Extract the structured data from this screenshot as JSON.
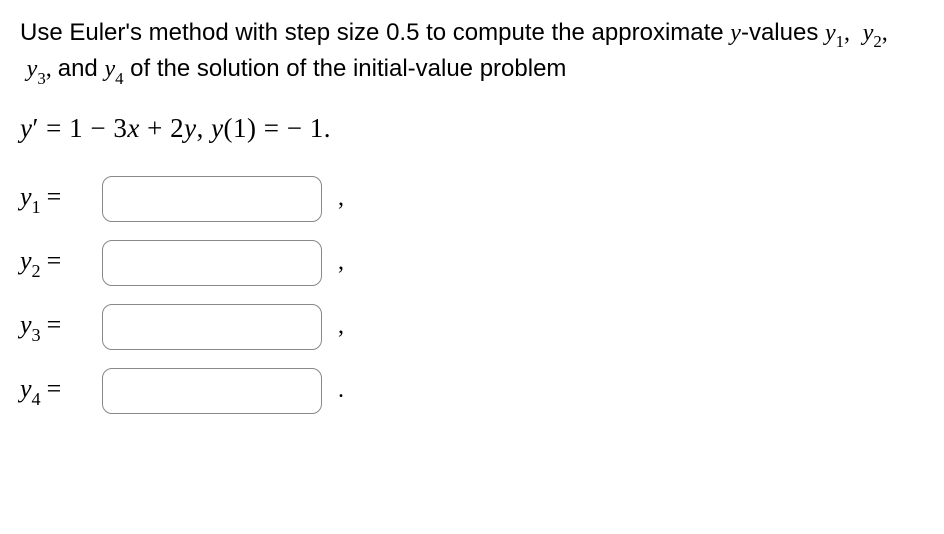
{
  "problem": {
    "text_part1": "Use Euler's method with step size ",
    "step_size": "0.5",
    "text_part2": " to compute the approximate ",
    "y_var": "y",
    "text_part3": "-values ",
    "y1": "y",
    "sub1": "1",
    "comma1": ", ",
    "y2": "y",
    "sub2": "2",
    "comma2": ", ",
    "y3": "y",
    "sub3": "3",
    "comma3": ", ",
    "text_and": " and ",
    "y4": "y",
    "sub4": "4",
    "text_part4": " of the solution of the initial-value problem"
  },
  "equation": {
    "lhs_y": "y",
    "prime": "′",
    "eq1": " = ",
    "one": "1",
    "minus": " − ",
    "three": "3",
    "x": "x",
    "plus": " + ",
    "two": "2",
    "y2": "y",
    "comma": ",   ",
    "ycond": "y",
    "open": "(",
    "arg": "1",
    "close": ")",
    "eq2": " = ",
    "neg": " − ",
    "val": "1",
    "period": "."
  },
  "answers": [
    {
      "var": "y",
      "sub": "1",
      "eq": "=",
      "value": "",
      "trail": ","
    },
    {
      "var": "y",
      "sub": "2",
      "eq": "=",
      "value": "",
      "trail": ","
    },
    {
      "var": "y",
      "sub": "3",
      "eq": "=",
      "value": "",
      "trail": ","
    },
    {
      "var": "y",
      "sub": "4",
      "eq": "=",
      "value": "",
      "trail": "."
    }
  ]
}
